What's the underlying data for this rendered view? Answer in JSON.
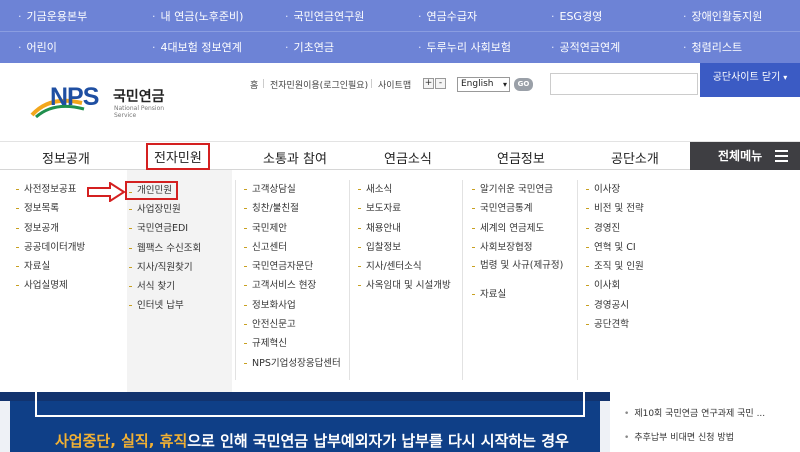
{
  "top_links": {
    "row1": [
      "기금운용본부",
      "내 연금(노후준비)",
      "국민연금연구원",
      "연금수급자",
      "ESG경영",
      "장애인활동지원"
    ],
    "row2": [
      "어린이",
      "4대보험 정보연계",
      "기초연금",
      "두루누리 사회보험",
      "공적연금연계",
      "청렴리스트"
    ]
  },
  "logo": {
    "text": "NPS",
    "korean": "국민연금",
    "english": "National Pension Service"
  },
  "util": {
    "home": "홈",
    "e_service": "전자민원이용(로그인필요)",
    "sitemap": "사이트맵",
    "zoom_in": "+",
    "zoom_out": "-",
    "language": "English",
    "go": "GO"
  },
  "site_button": "공단사이트 닫기",
  "nav": {
    "items": [
      "정보공개",
      "전자민원",
      "소통과 참여",
      "연금소식",
      "연금정보",
      "공단소개"
    ],
    "all_menu": "전체메뉴",
    "active_index": 1
  },
  "menu": {
    "col1": [
      "사전정보공표",
      "정보목록",
      "정보공개",
      "공공데이터개방",
      "자료실",
      "사업실명제"
    ],
    "col2": [
      "개인민원",
      "사업장민원",
      "국민연금EDI",
      "웹팩스 수신조회",
      "지사/직원찾기",
      "서식 찾기",
      "인터넷 납부"
    ],
    "col3": [
      "고객상담실",
      "칭찬/불친절",
      "국민제안",
      "신고센터",
      "국민연금자문단",
      "고객서비스 현장",
      "정보화사업",
      "안전신문고",
      "규제혁신",
      "NPS기업성장응답센터"
    ],
    "col4": [
      "새소식",
      "보도자료",
      "채용안내",
      "입찰정보",
      "지사/센터소식",
      "사옥임대 및 시설개방"
    ],
    "col5": [
      "알기쉬운 국민연금",
      "국민연금통계",
      "세계의 연금제도",
      "사회보장협정",
      "법령 및 사규(제규정)",
      "자료실"
    ],
    "col6": [
      "이사장",
      "비전 및 전략",
      "경영진",
      "연혁 및 CI",
      "조직 및 인원",
      "이사회",
      "경영공시",
      "공단견학"
    ]
  },
  "banner": {
    "accent": "사업중단, 실직, 휴직",
    "text": "으로 인해 국민연금 납부예외자가 납부를 다시 시작하는 경우"
  },
  "news": [
    "제10회 국민연금 연구과제 국민 ...",
    "추후납부 비대면 신청 방법"
  ],
  "colors": {
    "top_bar": "#6d83d6",
    "site_button": "#3b5bc4",
    "highlight": "#d42020",
    "all_menu": "#3e3e42"
  }
}
